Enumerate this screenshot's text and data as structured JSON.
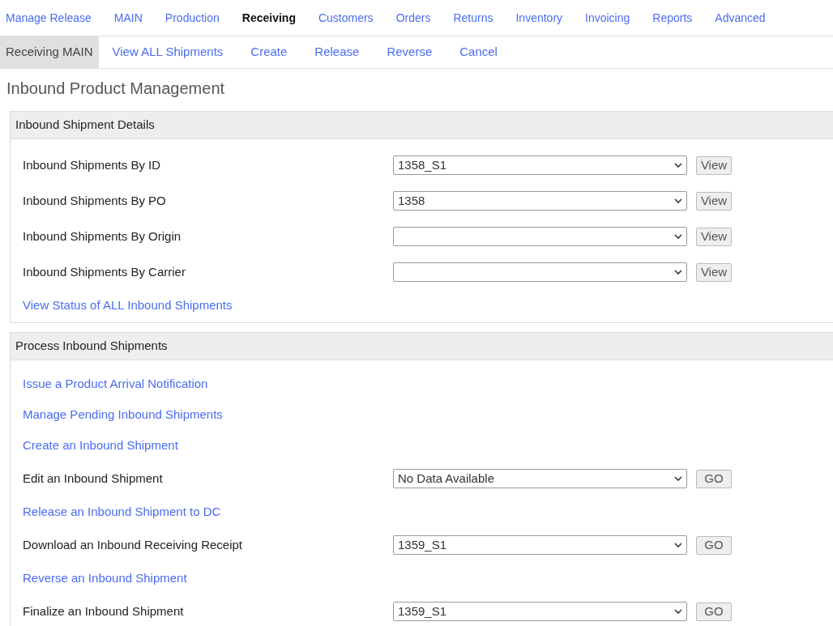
{
  "nav": {
    "tabs": [
      {
        "label": "Manage Release",
        "selected": false
      },
      {
        "label": "MAIN",
        "selected": false
      },
      {
        "label": "Production",
        "selected": false
      },
      {
        "label": "Receiving",
        "selected": true
      },
      {
        "label": "Customers",
        "selected": false
      },
      {
        "label": "Orders",
        "selected": false
      },
      {
        "label": "Returns",
        "selected": false
      },
      {
        "label": "Inventory",
        "selected": false
      },
      {
        "label": "Invoicing",
        "selected": false
      },
      {
        "label": "Reports",
        "selected": false
      },
      {
        "label": "Advanced",
        "selected": false
      }
    ]
  },
  "subnav": {
    "tabs": [
      {
        "label": "Receiving MAIN",
        "selected": true
      },
      {
        "label": "View ALL Shipments",
        "selected": false
      },
      {
        "label": "Create",
        "selected": false
      },
      {
        "label": "Release",
        "selected": false
      },
      {
        "label": "Reverse",
        "selected": false
      },
      {
        "label": "Cancel",
        "selected": false
      }
    ]
  },
  "title": "Inbound Product Management",
  "sections": [
    {
      "title": "Inbound Shipment Details",
      "rows": [
        {
          "kind": "select",
          "label": "Inbound Shipments By ID",
          "value": "1358_S1",
          "button": "View"
        },
        {
          "kind": "select",
          "label": "Inbound Shipments By PO",
          "value": "1358",
          "button": "View"
        },
        {
          "kind": "select",
          "label": "Inbound Shipments By Origin",
          "button": "View"
        },
        {
          "kind": "select",
          "label": "Inbound Shipments By Carrier",
          "button": "View"
        },
        {
          "kind": "link",
          "label": "View Status of ALL Inbound Shipments"
        }
      ]
    },
    {
      "title": "Process Inbound Shipments",
      "rows": [
        {
          "kind": "link",
          "label": "Issue a Product Arrival Notification"
        },
        {
          "kind": "link",
          "label": "Manage Pending Inbound Shipments"
        },
        {
          "kind": "link",
          "label": "Create an Inbound Shipment"
        },
        {
          "kind": "select",
          "label": "Edit an Inbound Shipment",
          "value": "No Data Available",
          "button": "GO"
        },
        {
          "kind": "link",
          "label": "Release an Inbound Shipment to DC"
        },
        {
          "kind": "select",
          "label": "Download an Inbound Receiving Receipt",
          "value": "1359_S1",
          "button": "GO"
        },
        {
          "kind": "link",
          "label": "Reverse an Inbound Shipment"
        },
        {
          "kind": "select",
          "label": "Finalize an Inbound Shipment",
          "value": "1359_S1",
          "button": "GO"
        }
      ]
    }
  ]
}
